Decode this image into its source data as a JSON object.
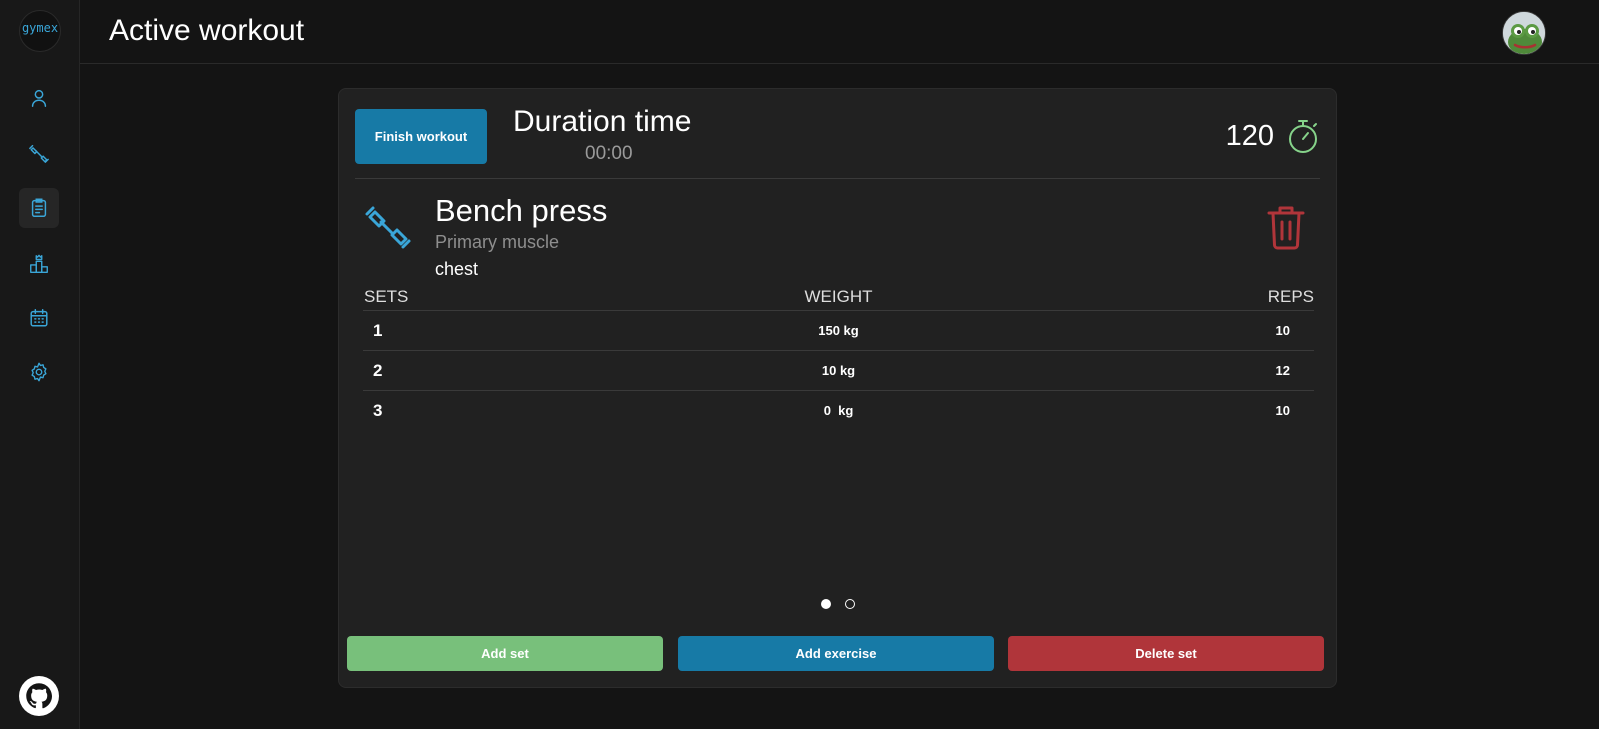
{
  "app": {
    "logo_text": "gymex",
    "page_title": "Active workout"
  },
  "colors": {
    "accent": "#177aa6",
    "icon": "#3aa6d8",
    "success": "#78c07b",
    "danger": "#b0353a",
    "background": "#141414",
    "card": "#212121"
  },
  "sidebar": {
    "items": [
      {
        "name": "profile",
        "icon": "user-icon",
        "active": false
      },
      {
        "name": "exercises",
        "icon": "dumbbell-icon",
        "active": false
      },
      {
        "name": "active-workout",
        "icon": "clipboard-icon",
        "active": true
      },
      {
        "name": "ranking",
        "icon": "podium-icon",
        "active": false
      },
      {
        "name": "calendar",
        "icon": "calendar-icon",
        "active": false
      },
      {
        "name": "settings",
        "icon": "gear-icon",
        "active": false
      }
    ],
    "footer_icon": "github-icon"
  },
  "workout": {
    "finish_label": "Finish workout",
    "duration_title": "Duration time",
    "duration_value": "00:00",
    "rest_value": "120",
    "rest_icon": "stopwatch-icon"
  },
  "exercise": {
    "name": "Bench press",
    "muscle_label": "Primary muscle",
    "muscle_value": "chest",
    "icon": "dumbbell-icon",
    "delete_icon": "trash-icon"
  },
  "table": {
    "headers": {
      "sets": "SETS",
      "weight": "WEIGHT",
      "reps": "REPS"
    },
    "rows": [
      {
        "set": "1",
        "weight": "150 kg",
        "reps": "10"
      },
      {
        "set": "2",
        "weight": "10 kg",
        "reps": "12"
      },
      {
        "set": "3",
        "weight": "0  kg",
        "reps": "10"
      }
    ]
  },
  "pagination": {
    "total": 2,
    "current": 1
  },
  "actions": {
    "add_set": "Add set",
    "add_exercise": "Add exercise",
    "delete_set": "Delete set"
  }
}
